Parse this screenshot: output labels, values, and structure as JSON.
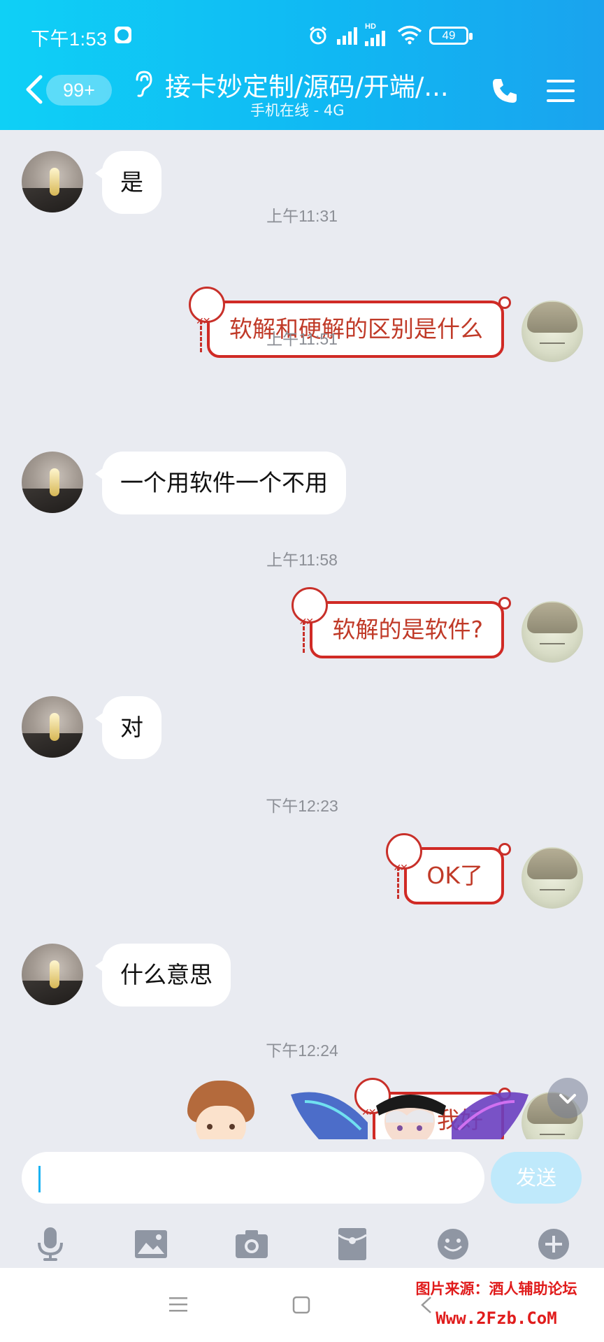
{
  "status_bar": {
    "time": "下午1:53",
    "battery": "49",
    "network_label": "HD"
  },
  "header": {
    "unread_count": "99+",
    "title": "接卡妙定制/源码/开端/...",
    "subtitle": "手机在线 - 4G"
  },
  "messages": {
    "m1": "是",
    "t1": "上午11:31",
    "m2": "软解和硬解的区别是什么",
    "t2": "上午11:51",
    "m3": "一个用软件一个不用",
    "t3": "上午11:58",
    "m4": "软解的是软件?",
    "m5": "对",
    "t4": "下午12:23",
    "m6": "OK了",
    "m7": "什么意思",
    "t5": "下午12:24",
    "m8_partial": "我好"
  },
  "input": {
    "placeholder": "",
    "send_label": "发送"
  },
  "toolbar": {
    "icons": [
      "microphone-icon",
      "image-icon",
      "camera-icon",
      "red-packet-icon",
      "emoji-icon",
      "plus-icon"
    ]
  },
  "watermark": {
    "line1": "图片来源：酒人辅助论坛",
    "line2": "Www.2Fzb.CoM"
  },
  "colors": {
    "header_start": "#0fd0f6",
    "header_end": "#1aa3ee",
    "bubble_out_border": "#d02a25",
    "bubble_out_text": "#c03a28",
    "chat_background": "#e9ebf1",
    "send_button": "#bfe9fb"
  }
}
